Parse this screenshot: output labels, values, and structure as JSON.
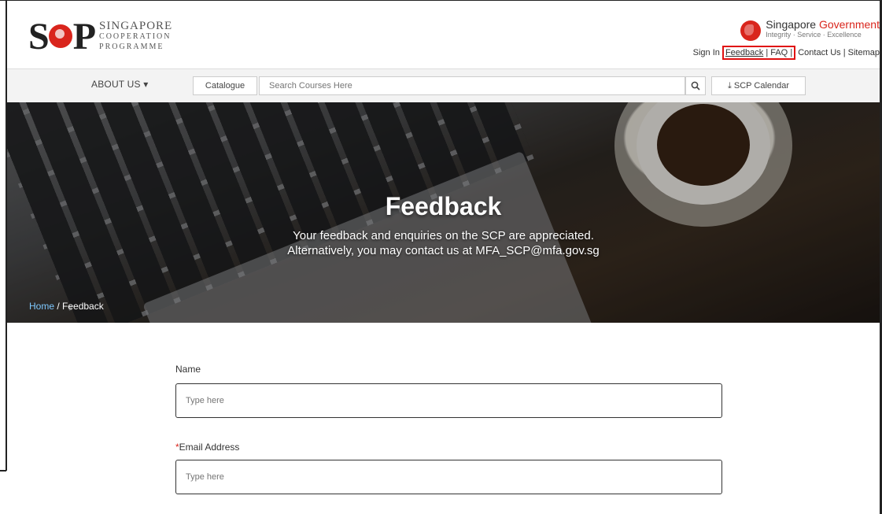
{
  "logo": {
    "mark": "SCP",
    "line1": "SINGAPORE",
    "line2": "COOPERATION",
    "line3": "PROGRAMME"
  },
  "gov": {
    "title_main": "Singapore",
    "title_accent": "Government",
    "tagline": "Integrity · Service · Excellence",
    "icon": "lion-head-icon"
  },
  "util_links": {
    "sign_in": "Sign In",
    "feedback": "Feedback",
    "sep": "|",
    "faq": "FAQ",
    "contact": "Contact Us",
    "sitemap": "Sitemap"
  },
  "nav": {
    "about": "ABOUT US",
    "catalogue": "Catalogue",
    "search_placeholder": "Search Courses Here",
    "calendar": "SCP Calendar"
  },
  "hero": {
    "title": "Feedback",
    "sub1": "Your feedback and enquiries on the SCP are appreciated.",
    "sub2": "Alternatively, you may contact us at MFA_SCP@mfa.gov.sg"
  },
  "breadcrumb": {
    "home": "Home",
    "sep": " / ",
    "current": "Feedback"
  },
  "form": {
    "name_label": "Name",
    "name_placeholder": "Type here",
    "email_required_mark": "*",
    "email_label": "Email Address",
    "email_placeholder": "Type here"
  },
  "colors": {
    "accent_red": "#d9251c",
    "highlight_box": "#e01010",
    "link_blue": "#7ec8ff"
  }
}
